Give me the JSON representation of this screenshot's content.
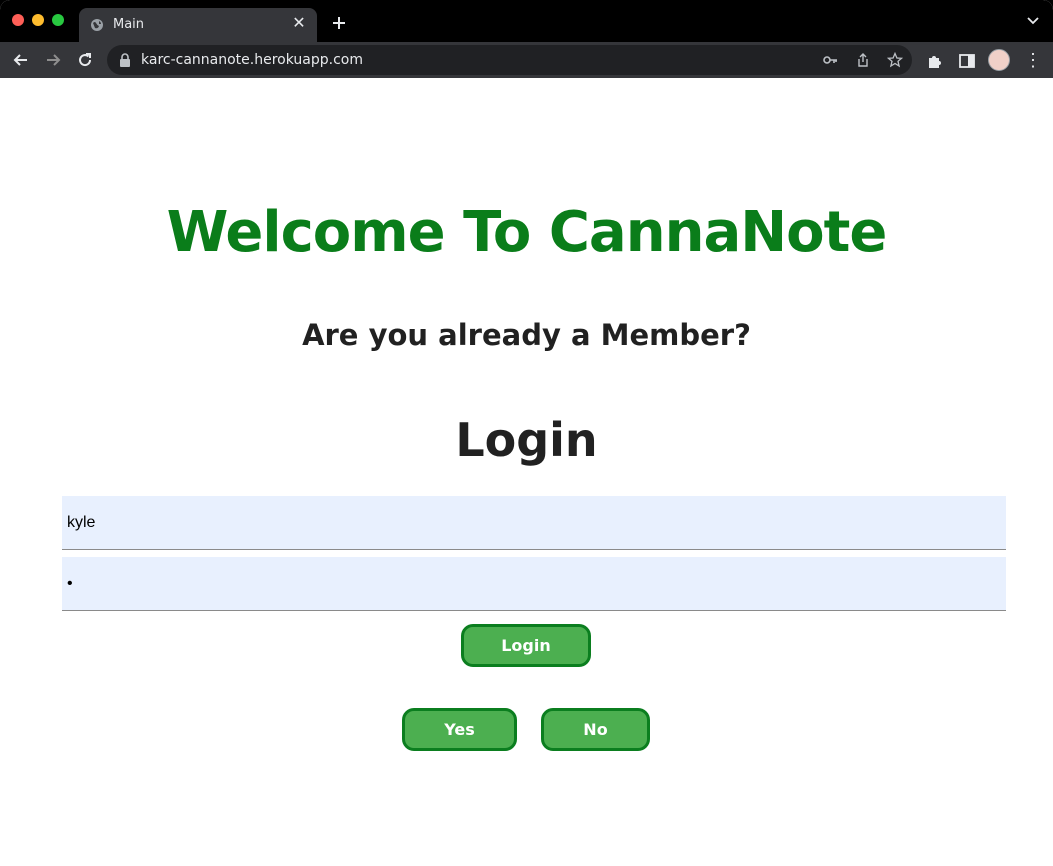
{
  "browser": {
    "tab_title": "Main",
    "url": "karc-cannanote.herokuapp.com",
    "icons": [
      "globe-icon",
      "close-icon",
      "plus-icon",
      "chevron-down-icon",
      "back-arrow-icon",
      "forward-arrow-icon",
      "reload-icon",
      "lock-icon",
      "key-icon",
      "share-icon",
      "star-icon",
      "puzzle-icon",
      "side-panel-icon",
      "avatar",
      "kebab-icon"
    ]
  },
  "page": {
    "heading": "Welcome To CannaNote",
    "heading_color": "#0a7d1a",
    "question": "Are you already a Member?",
    "login_heading": "Login",
    "username_value": "kyle",
    "password_value": "•",
    "login_button": "Login",
    "yes_button": "Yes",
    "no_button": "No",
    "button_color": "#4caf50",
    "button_border_color": "#0b7e1f",
    "field_background": "#e8f0fe"
  }
}
